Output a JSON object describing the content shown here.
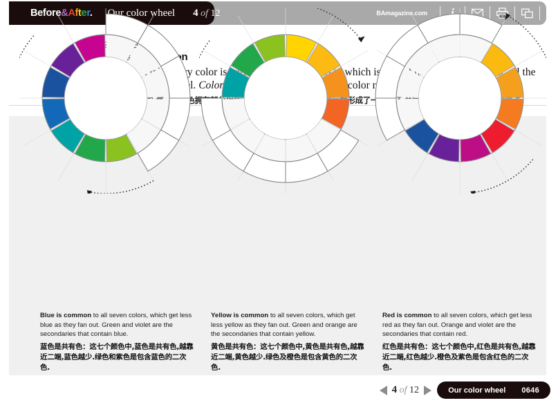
{
  "header": {
    "logo": {
      "before": "Before",
      "amp": "&",
      "after": "After",
      "dot": "."
    },
    "title": "Our color wheel",
    "page_current": "4",
    "page_of": "of",
    "page_total": "12",
    "site_url": "BAmagazine.com",
    "icons": [
      "info-icon",
      "envelope-icon",
      "printer-icon",
      "windows-icon"
    ]
  },
  "intro": {
    "cn_heading": "共同的颜色",
    "en_heading": "Colors in common",
    "en_body_1": "As you can tell, every color is part of the color next to it, which is part of the next and the next, all the way around the wheel. ",
    "en_body_italic": "Colors in common",
    "en_body_2": " are the basis of color relationships.",
    "cn_body": "正如你所看到的,每一种颜色拥有部分相邻的颜色,一部份接一部份,然后就形成了一个色环.共同的颜色是颜色关系的基本要点"
  },
  "wheels": [
    {
      "name": "blue-wheel",
      "colors": [
        null,
        null,
        null,
        null,
        null,
        "#8CC220",
        "#22A84B",
        "#00A3A5",
        "#1368B8",
        "#1B52A0",
        "#69219A",
        "#C6048F"
      ],
      "arrows": [
        "left-up-arrow",
        "bottom-arrow"
      ]
    },
    {
      "name": "yellow-wheel",
      "colors": [
        "#FFD400",
        "#FDBA12",
        "#F5921E",
        "#F26522",
        null,
        null,
        null,
        null,
        null,
        null,
        "#00A3A5",
        "#22A84B"
      ],
      "extra": {
        "index": 11,
        "color": "#8CC220"
      },
      "arrows": [
        "top-left-arrow",
        "top-right-arrow"
      ]
    },
    {
      "name": "red-wheel",
      "colors": [
        null,
        "#FBBA10",
        "#F5A01C",
        "#F47B20",
        "#ED1C2E",
        "#BE0E85",
        "#69219A",
        "#1B52A0",
        null,
        null,
        null,
        null
      ],
      "arrows": [
        "right-up-arrow",
        "bottom-right-arrow"
      ]
    }
  ],
  "captions": [
    {
      "en_bold": "Blue is common",
      "en_rest": " to all seven colors, which get less blue as they fan out. Green and violet are the secondaries that contain blue.",
      "cn": "蓝色是共有色：这七个颜色中,蓝色是共有色,越靠近二端,蓝色越少.绿色和紫色是包含蓝色的二次色."
    },
    {
      "en_bold": "Yellow is common",
      "en_rest": " to all seven colors, which get less yellow as they fan out. Green and orange are the secondaries that contain yellow.",
      "cn": "黄色是共有色：这七个颜色中,黄色是共有色,越靠近二端,黄色越少.绿色及橙色是包含黄色的二次色."
    },
    {
      "en_bold": "Red is common",
      "en_rest": " to all seven colors, which get less red as they fan out. Orange and violet are the secondaries that contain red.",
      "cn": "红色是共有色：这七个颜色中,红色是共有色,越靠近二端,红色越少.橙色及紫色是包含红色的二次色."
    }
  ],
  "footer": {
    "prev": "prev-arrow",
    "next": "next-arrow",
    "page_current": "4",
    "page_of": "of",
    "page_total": "12",
    "title": "Our color wheel",
    "code": "0646"
  },
  "theme": {
    "header_dark": "#1a0c0c",
    "header_gray": "#a9a9a9",
    "panel_bg": "#f0f0f0"
  }
}
